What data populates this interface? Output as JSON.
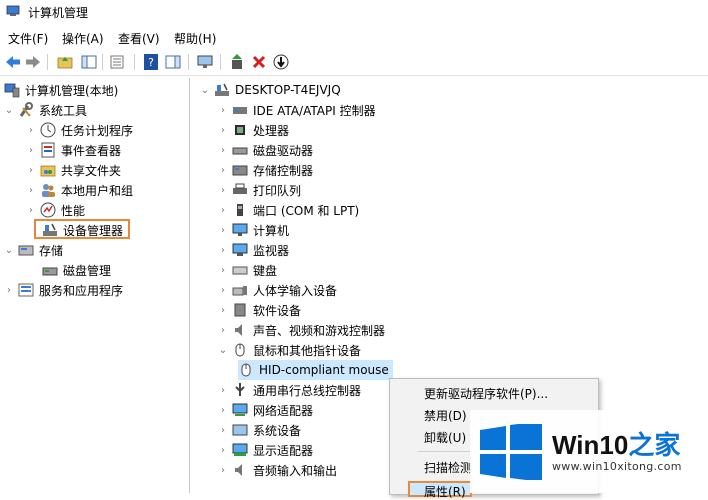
{
  "window": {
    "title": "计算机管理"
  },
  "menu": [
    {
      "label": "文件(F)"
    },
    {
      "label": "操作(A)"
    },
    {
      "label": "查看(V)"
    },
    {
      "label": "帮助(H)"
    }
  ],
  "left_tree": {
    "root": "计算机管理(本地)",
    "system_tools": "系统工具",
    "task_scheduler": "任务计划程序",
    "event_viewer": "事件查看器",
    "shared_folders": "共享文件夹",
    "local_users": "本地用户和组",
    "performance": "性能",
    "device_manager": "设备管理器",
    "storage": "存储",
    "disk_management": "磁盘管理",
    "services_apps": "服务和应用程序"
  },
  "device_tree": {
    "computer_name": "DESKTOP-T4EJVJQ",
    "categories": [
      {
        "label": "IDE ATA/ATAPI 控制器",
        "icon": "ide-controller-icon"
      },
      {
        "label": "处理器",
        "icon": "processor-icon"
      },
      {
        "label": "磁盘驱动器",
        "icon": "disk-drive-icon"
      },
      {
        "label": "存储控制器",
        "icon": "storage-controller-icon"
      },
      {
        "label": "打印队列",
        "icon": "printer-icon"
      },
      {
        "label": "端口 (COM 和 LPT)",
        "icon": "port-icon"
      },
      {
        "label": "计算机",
        "icon": "computer-icon"
      },
      {
        "label": "监视器",
        "icon": "monitor-icon"
      },
      {
        "label": "键盘",
        "icon": "keyboard-icon"
      },
      {
        "label": "人体学输入设备",
        "icon": "hid-icon"
      },
      {
        "label": "软件设备",
        "icon": "software-device-icon"
      },
      {
        "label": "声音、视频和游戏控制器",
        "icon": "speaker-icon"
      },
      {
        "label": "鼠标和其他指针设备",
        "icon": "mouse-icon"
      },
      {
        "label": "HID-compliant mouse",
        "icon": "mouse-icon"
      },
      {
        "label": "通用串行总线控制器",
        "icon": "usb-icon"
      },
      {
        "label": "网络适配器",
        "icon": "network-adapter-icon"
      },
      {
        "label": "系统设备",
        "icon": "system-device-icon"
      },
      {
        "label": "显示适配器",
        "icon": "display-adapter-icon"
      },
      {
        "label": "音频输入和输出",
        "icon": "speaker-icon"
      }
    ]
  },
  "context_menu": {
    "update_driver": "更新驱动程序软件(P)...",
    "disable": "禁用(D)",
    "uninstall": "卸载(U)",
    "scan": "扫描检测",
    "properties": "属性(R)"
  },
  "watermark": {
    "brand_prefix": "Win10",
    "brand_suffix": "之家",
    "url": "www.win10xitong.com"
  },
  "colors": {
    "highlight_border": "#e8883a",
    "selection": "#cce8ff",
    "win_logo": "#0a74d6"
  }
}
